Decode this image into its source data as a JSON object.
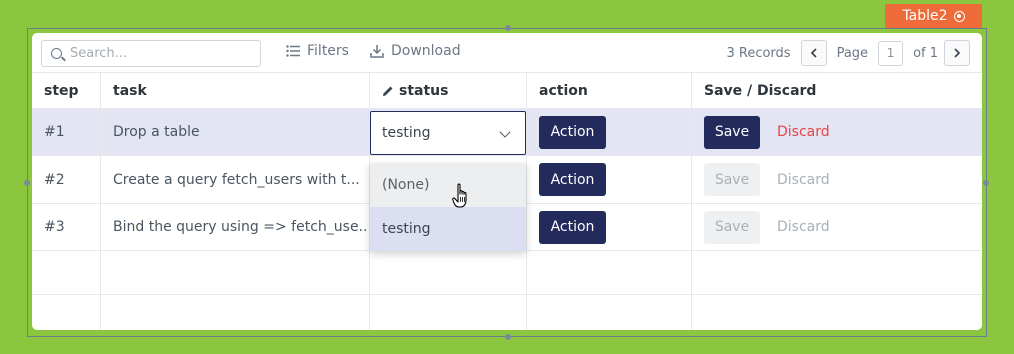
{
  "widget": {
    "name": "Table2",
    "accent": "#f06b3a"
  },
  "toolbar": {
    "search_placeholder": "Search...",
    "filters_label": "Filters",
    "download_label": "Download",
    "records": "3 Records",
    "page_label": "Page",
    "page_current": "1",
    "page_total": "of 1"
  },
  "columns": [
    "step",
    "task",
    "status",
    "action",
    "Save / Discard"
  ],
  "rows": [
    {
      "step": "#1",
      "task": "Drop a table",
      "status": "testing",
      "action": "Action",
      "save": "Save",
      "discard": "Discard"
    },
    {
      "step": "#2",
      "task": "Create a query fetch_users with t...",
      "status": "",
      "action": "Action",
      "save": "Save",
      "discard": "Discard"
    },
    {
      "step": "#3",
      "task": "Bind the query using => fetch_use...",
      "status": "",
      "action": "Action",
      "save": "Save",
      "discard": "Discard"
    }
  ],
  "status_dropdown": {
    "value": "testing",
    "options": [
      "(None)",
      "testing"
    ]
  },
  "colors": {
    "primary": "#232a5c",
    "danger": "#e54545",
    "canvas": "#8cc63f",
    "row_selected": "#e3e5f2"
  }
}
